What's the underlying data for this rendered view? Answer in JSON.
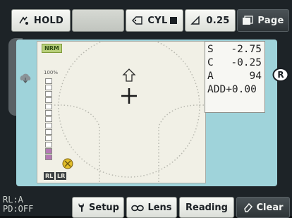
{
  "toolbar": {
    "hold_label": "HOLD",
    "cyl_label": "CYL",
    "step_value": "0.25",
    "page_label": "Page"
  },
  "view": {
    "mode_badge": "NRM",
    "bar_scale_label": "100%",
    "bar_filled_segments": 2,
    "bar_total_segments": 13,
    "bar_bottom_labels": [
      "RL",
      "LR"
    ]
  },
  "readout": {
    "s_key": "S",
    "s_value": "-2.75",
    "c_key": "C",
    "c_value": "-0.25",
    "a_key": "A",
    "a_value": "94",
    "add_text": "ADD+0.00"
  },
  "side_marker": "R",
  "status": {
    "rl_text": "RL:A",
    "pd_text": "PD:OFF"
  },
  "bottom": {
    "setup_label": "Setup",
    "lens_label": "Lens",
    "reading_label": "Reading",
    "clear_label": "Clear"
  },
  "colors": {
    "panel_accent": "#9fd3da",
    "bar_fill": "#b478b4",
    "target_icon": "#e2be2a"
  }
}
